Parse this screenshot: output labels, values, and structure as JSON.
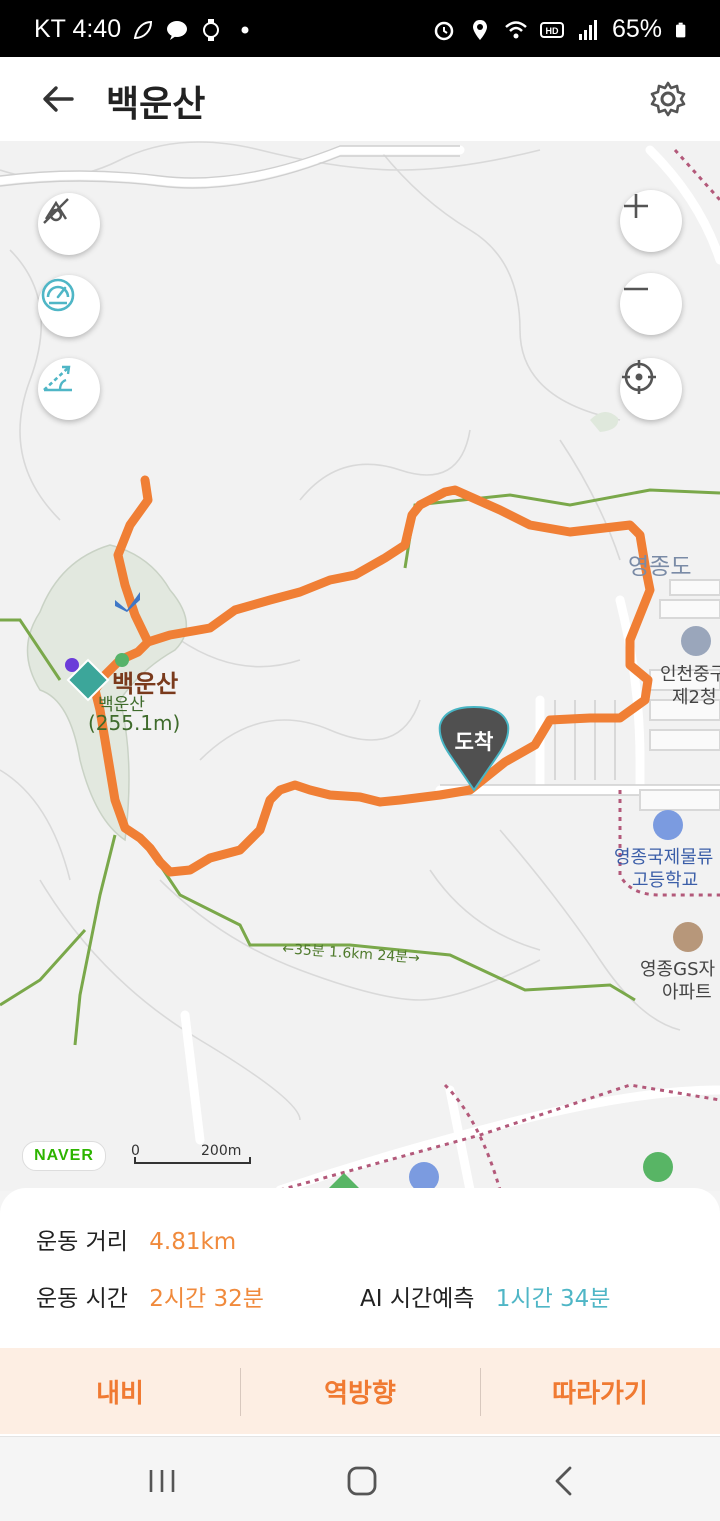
{
  "status_bar": {
    "carrier_time": "KT 4:40",
    "battery": "65%",
    "icons": [
      "leaf-icon",
      "talk-icon",
      "watch-icon",
      "dot-icon",
      "alarm-icon",
      "location-icon",
      "wifi-icon",
      "hd-icon",
      "signal-icon",
      "battery-icon"
    ]
  },
  "header": {
    "title": "백운산",
    "back_icon": "arrow-left-icon",
    "settings_icon": "gear-icon"
  },
  "map": {
    "left_controls": [
      "track-off-icon",
      "speedometer-icon",
      "slope-icon"
    ],
    "right_controls": [
      "zoom-in-icon",
      "zoom-out-icon",
      "locate-icon"
    ],
    "labels": {
      "peak_name": "백운산",
      "peak_name_small": "백운산",
      "peak_elevation": "(255.1m)",
      "area_yeongjongdo": "영종도",
      "poi_incheon": "인천중구",
      "poi_incheon_2": "제2청",
      "poi_school": "영종국제물류",
      "poi_school_2": "고등학교",
      "poi_apt": "영종GS자",
      "poi_apt_2": "아파트",
      "trail_info": "←35분 1.6km 24분→",
      "arrival_marker": "도착"
    },
    "naver_logo": "NAVER",
    "scale_zero": "0",
    "scale_label": "200m",
    "route_color": "#f07f35",
    "trail_color": "#7aa84a"
  },
  "stats": {
    "distance_label": "운동 거리",
    "distance_value": "4.81km",
    "time_label": "운동 시간",
    "time_value": "2시간 32분",
    "ai_label": "AI 시간예측",
    "ai_value": "1시간 34분"
  },
  "actions": {
    "navi": "내비",
    "reverse": "역방향",
    "follow": "따라가기"
  },
  "nav_bar": [
    "recent-apps-icon",
    "home-icon",
    "back-icon"
  ]
}
